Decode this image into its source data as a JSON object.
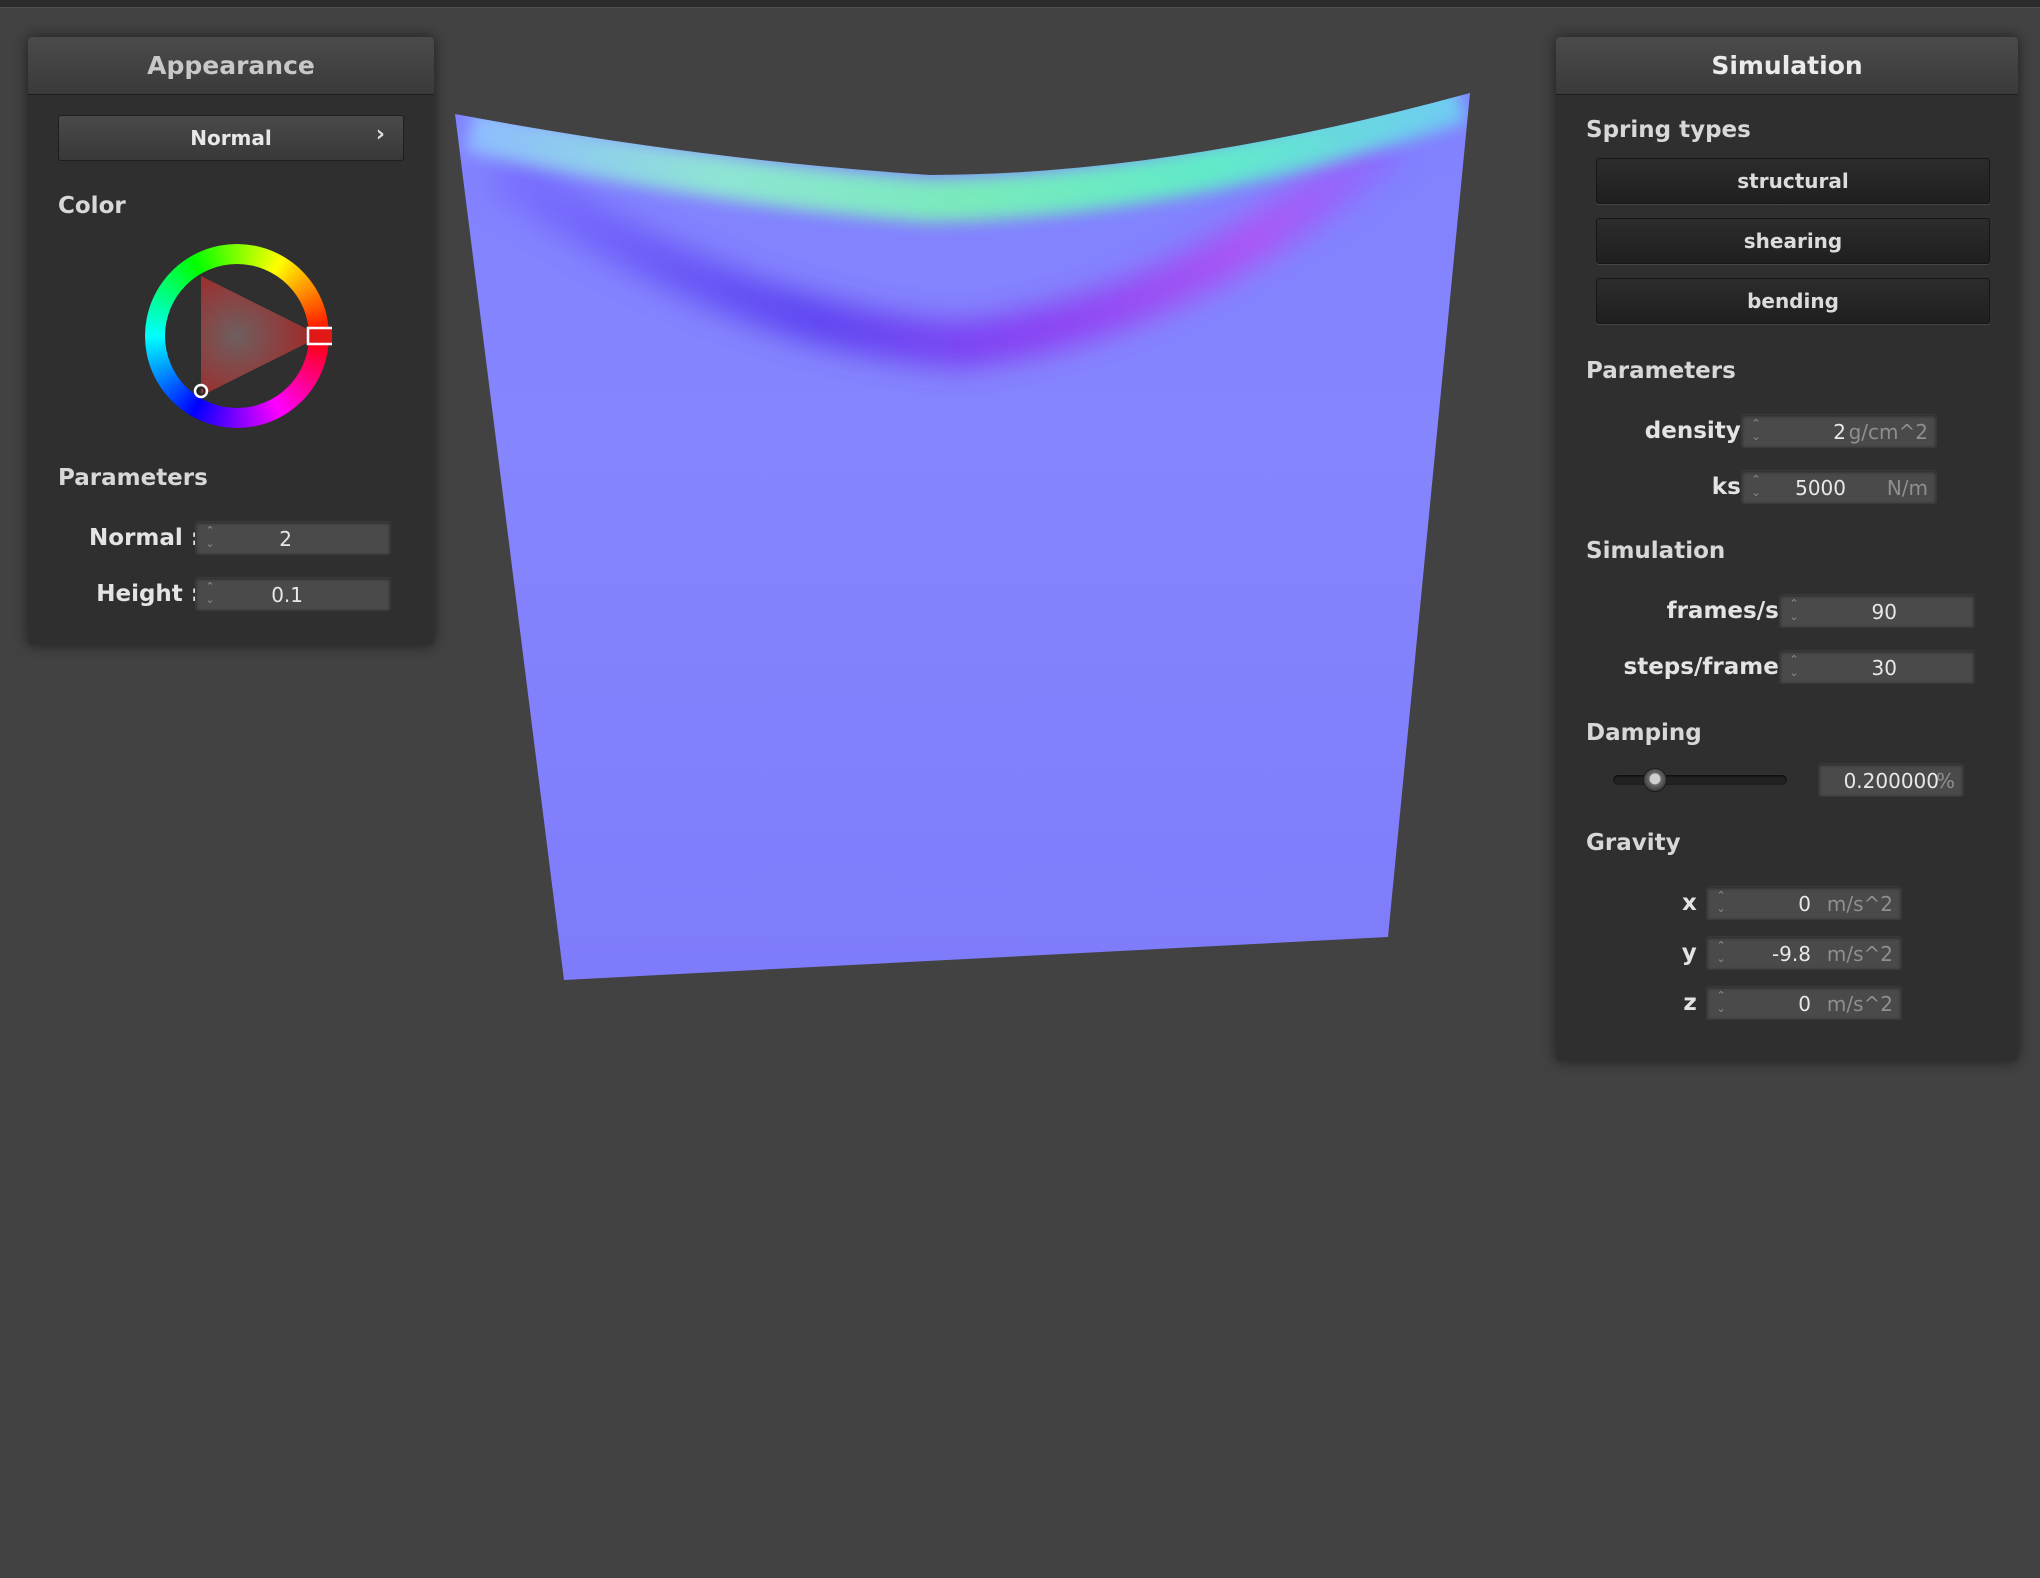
{
  "colors": {
    "background": "#424242",
    "panel": "#2f2f2f",
    "cloth_base": "#8080ff",
    "selected_color": "#ff0000"
  },
  "appearance": {
    "title": "Appearance",
    "shader_dropdown": {
      "value": "Normal",
      "chevron": "›"
    },
    "color_label": "Color",
    "color_wheel_icon": "color-wheel-icon",
    "parameters_label": "Parameters",
    "params": [
      {
        "label": "Normal :",
        "value": "2"
      },
      {
        "label": "Height :",
        "value": "0.1"
      }
    ]
  },
  "simulation": {
    "title": "Simulation",
    "spring_types_label": "Spring types",
    "spring_buttons": [
      "structural",
      "shearing",
      "bending"
    ],
    "parameters_label": "Parameters",
    "density": {
      "label": "density :",
      "value": "2",
      "unit": "g/cm^2"
    },
    "ks": {
      "label": "ks :",
      "value": "5000",
      "unit": "N/m"
    },
    "simulation_label": "Simulation",
    "frames": {
      "label": "frames/s :",
      "value": "90"
    },
    "steps": {
      "label": "steps/frame :",
      "value": "30"
    },
    "damping_label": "Damping",
    "damping": {
      "value": "0.200000",
      "unit": "%",
      "slider_fraction": 0.2
    },
    "gravity_label": "Gravity",
    "gravity": [
      {
        "label": "x :",
        "value": "0",
        "unit": "m/s^2"
      },
      {
        "label": "y :",
        "value": "-9.8",
        "unit": "m/s^2"
      },
      {
        "label": "z :",
        "value": "0",
        "unit": "m/s^2"
      }
    ]
  }
}
